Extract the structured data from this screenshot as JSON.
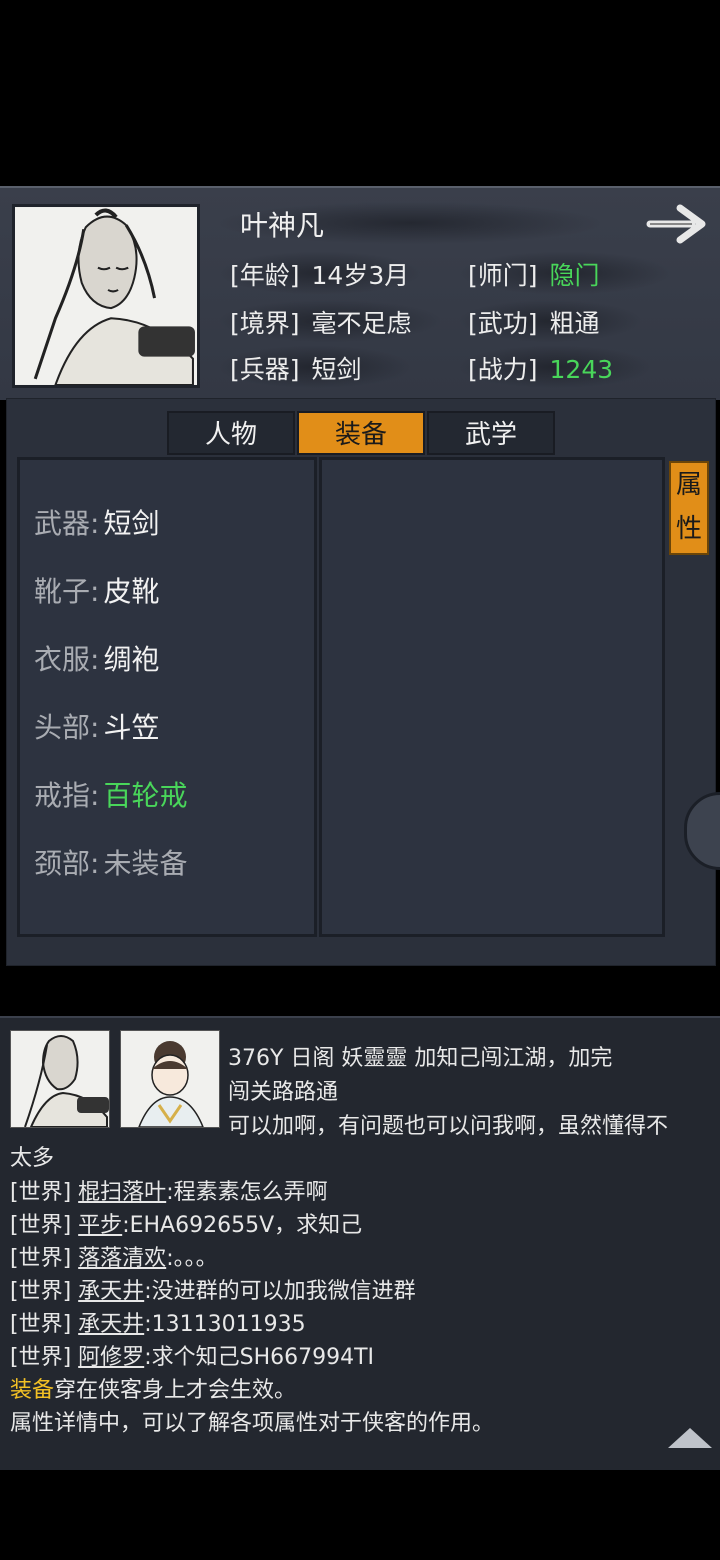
{
  "header": {
    "name": "叶神凡",
    "stats": [
      {
        "key": "[年龄]",
        "value": "14岁3月"
      },
      {
        "key": "[师门]",
        "value": "隐门"
      },
      {
        "key": "[境界]",
        "value": "毫不足虑"
      },
      {
        "key": "[武功]",
        "value": "粗通"
      },
      {
        "key": "[兵器]",
        "value": "短剑"
      },
      {
        "key": "[战力]",
        "value": "1243"
      }
    ]
  },
  "tabs": [
    "人物",
    "装备",
    "武学"
  ],
  "active_tab": "装备",
  "attr_tab": "属性",
  "equipment": [
    {
      "label": "武器:",
      "value": "短剑"
    },
    {
      "label": "靴子:",
      "value": "皮靴"
    },
    {
      "label": "衣服:",
      "value": "绸袍"
    },
    {
      "label": "头部:",
      "value": "斗笠"
    },
    {
      "label": "戒指:",
      "value": "百轮戒"
    },
    {
      "label": "颈部:",
      "value": "未装备"
    }
  ],
  "chat": {
    "partial_1": "376Y 日阁 妖靈靈  加知己闯江湖，加完",
    "partial_2": "闯关路路通",
    "partial_3": "可以加啊，有问题也可以问我啊，虽然懂得不",
    "partial_4": "太多",
    "messages": [
      {
        "tag": "[世界]",
        "user": "棍扫落叶",
        "text": ":程素素怎么弄啊"
      },
      {
        "tag": "[世界]",
        "user": "平步",
        "text": ":EHA692655V，求知己"
      },
      {
        "tag": "[世界]",
        "user": "落落清欢",
        "text": ":。。。"
      },
      {
        "tag": "[世界]",
        "user": "承天井",
        "text": ":没进群的可以加我微信进群"
      },
      {
        "tag": "[世界]",
        "user": "承天井",
        "text": ":13113011935"
      },
      {
        "tag": "[世界]",
        "user": "阿修罗",
        "text": ":求个知己SH667994TI"
      }
    ],
    "tip1_highlight": "装备",
    "tip1_rest": "穿在侠客身上才会生效。",
    "tip2": "属性详情中，可以了解各项属性对于侠客的作用。"
  },
  "colors": {
    "accent": "#e18e18",
    "green": "#49d65a",
    "gold": "#f2c025"
  }
}
